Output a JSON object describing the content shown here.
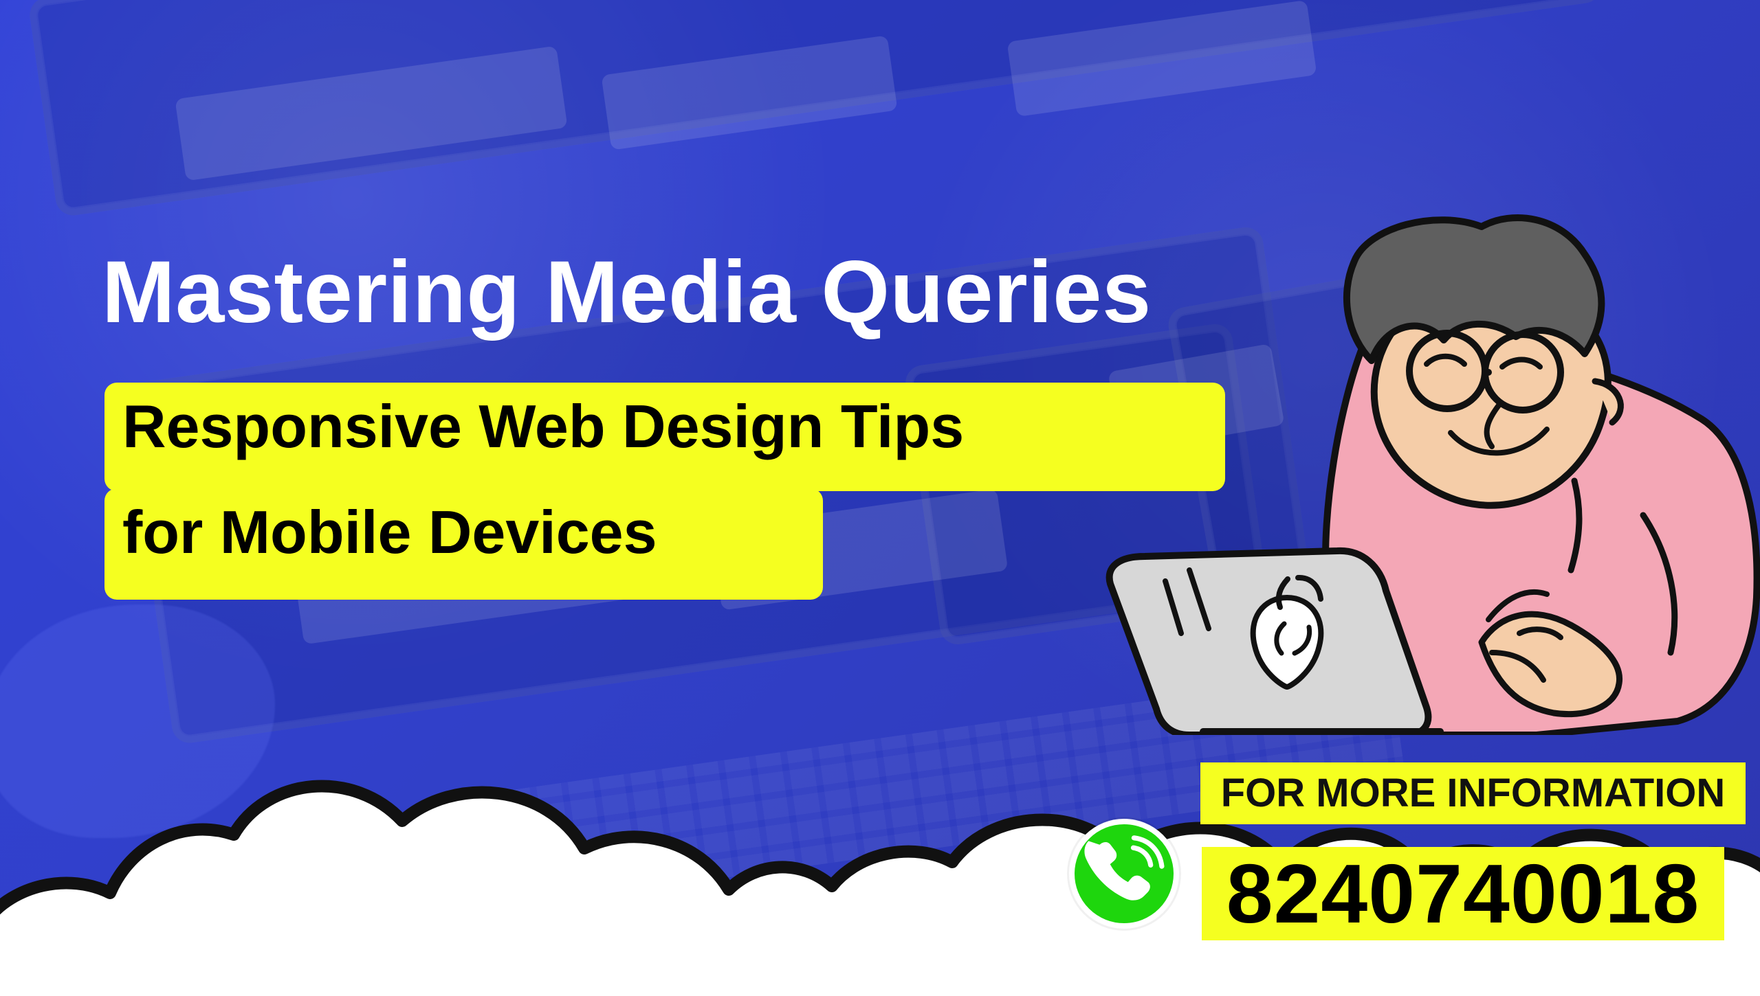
{
  "hero": {
    "title": "Mastering Media Queries",
    "subtitle_line_1": "Responsive Web Design Tips",
    "subtitle_line_2": "for Mobile Devices"
  },
  "contact": {
    "label": "FOR MORE INFORMATION",
    "phone_number": "8240740018"
  },
  "icons": {
    "phone": "phone-icon",
    "laptop": "laptop-icon",
    "brand": "brand-logo-icon",
    "person": "person-illustration"
  },
  "colors": {
    "background": "#3142d7",
    "highlight": "#f5ff20",
    "title_text": "#ffffff",
    "cloud": "#ffffff",
    "phone_icon": "#1ed60d",
    "sweater": "#f4a7b6",
    "hair": "#5f5f5f",
    "laptop": "#d6d6d6"
  }
}
